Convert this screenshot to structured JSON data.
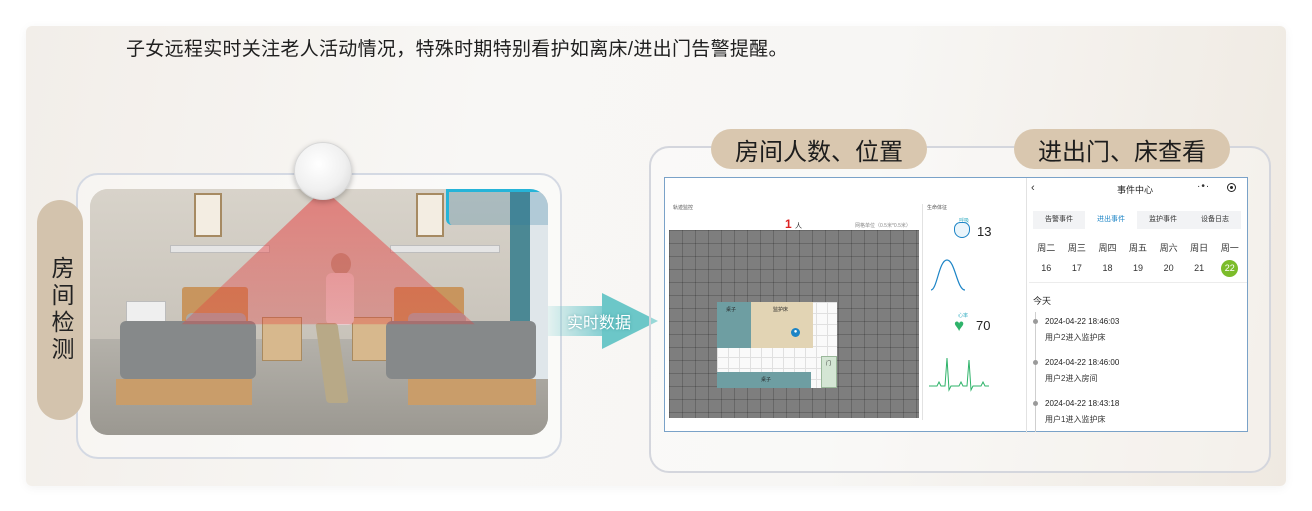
{
  "headline": "子女远程实时关注老人活动情况，特殊时期特别看护如离床/进出门告警提醒。",
  "left_label": "房间检测",
  "arrow_label": "实时数据",
  "pills": {
    "people_position": "房间人数、位置",
    "door_bed": "进出门、床查看"
  },
  "track": {
    "title": "轨迹监控",
    "count": "1",
    "count_unit": "人",
    "grid_unit": "网格单位（0.5米*0.5米）",
    "labels": {
      "desk_top": "桌子",
      "bed": "监护床",
      "desk_bottom": "桌子",
      "door": "门"
    }
  },
  "vitals": {
    "title": "生命体征",
    "breath_label": "呼吸",
    "breath_value": "13",
    "heart_label": "心率",
    "heart_value": "70"
  },
  "events": {
    "title": "事件中心",
    "more": "·•·",
    "tabs": [
      "告警事件",
      "进出事件",
      "监护事件",
      "设备日志"
    ],
    "active_tab": 1,
    "weekdays": [
      "周二",
      "周三",
      "周四",
      "周五",
      "周六",
      "周日",
      "周一"
    ],
    "days": [
      "16",
      "17",
      "18",
      "19",
      "20",
      "21",
      "22"
    ],
    "today_index": 6,
    "today_label": "今天",
    "items": [
      {
        "time": "2024-04-22 18:46:03",
        "desc": "用户2进入监护床"
      },
      {
        "time": "2024-04-22 18:46:00",
        "desc": "用户2进入房间"
      },
      {
        "time": "2024-04-22 18:43:18",
        "desc": "用户1进入监护床"
      }
    ]
  },
  "colors": {
    "pill": "#d9c7af",
    "accent_blue": "#1c84c6",
    "today_green": "#7cbc2a",
    "arrow_teal": "#6cc7c8",
    "alarm_red": "#dd2222"
  }
}
